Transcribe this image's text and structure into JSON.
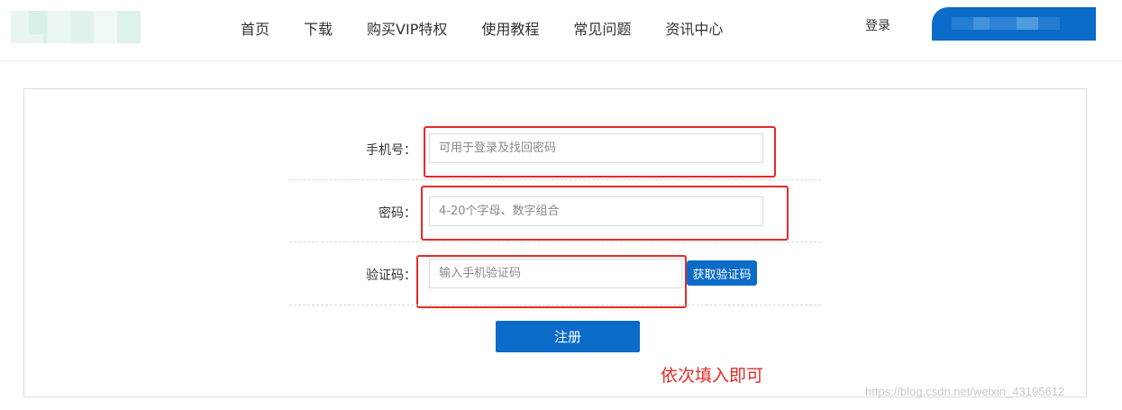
{
  "header": {
    "nav": [
      "首页",
      "下载",
      "购买VIP特权",
      "使用教程",
      "常见问题",
      "资讯中心"
    ],
    "login_label": "登录"
  },
  "form": {
    "phone": {
      "label": "手机号：",
      "placeholder": "可用于登录及找回密码",
      "value": ""
    },
    "password": {
      "label": "密码：",
      "placeholder": "4-20个字母、数字组合",
      "value": ""
    },
    "code": {
      "label": "验证码：",
      "placeholder": "输入手机验证码",
      "value": "",
      "button": "获取验证码"
    },
    "submit_label": "注册"
  },
  "annotation": {
    "note": "依次填入即可"
  },
  "watermark": "https://blog.csdn.net/weixin_43195612",
  "colors": {
    "accent": "#0b6bc9",
    "highlight": "#e62a2a"
  }
}
